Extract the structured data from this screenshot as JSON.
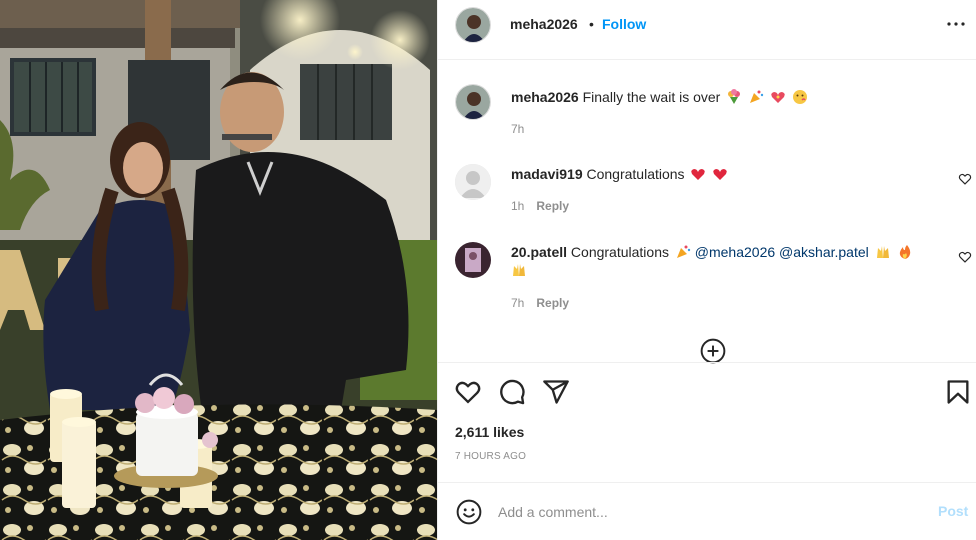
{
  "post": {
    "username": "meha2026",
    "follow_separator": "•",
    "follow_label": "Follow"
  },
  "comments": [
    {
      "username": "meha2026",
      "text": "Finally the wait is over",
      "emojis": [
        "bouquet-emoji",
        "party-popper-emoji",
        "sparkling-heart-emoji",
        "kissing-face-emoji"
      ],
      "time": "7h",
      "reply_label": ""
    },
    {
      "username": "madavi919",
      "text": "Congratulations",
      "emojis": [
        "red-heart-emoji",
        "red-heart-emoji"
      ],
      "time": "1h",
      "reply_label": "Reply"
    },
    {
      "username": "20.patell",
      "text": "Congratulations",
      "mention_1": "@meha2026",
      "mention_2": "@akshar.patel",
      "emojis": [
        "party-popper-emoji",
        "raising-hands-emoji",
        "fire-emoji",
        "raising-hands-emoji"
      ],
      "time": "7h",
      "reply_label": "Reply"
    }
  ],
  "stats": {
    "likes": "2,611 likes",
    "posted_ago": "7 HOURS AGO"
  },
  "add_comment": {
    "placeholder": "Add a comment...",
    "post_label": "Post"
  },
  "colors": {
    "link_blue": "#0095f6",
    "post_disabled": "#b2dffc",
    "meta_gray": "#8e8e8e",
    "heart_red": "#ed4956"
  },
  "icons": {
    "more": "more-options-icon",
    "like": "heart-icon",
    "comment": "comment-icon",
    "share": "share-icon",
    "save": "bookmark-icon",
    "load_more": "plus-circle-icon",
    "emoji": "smiley-icon"
  }
}
